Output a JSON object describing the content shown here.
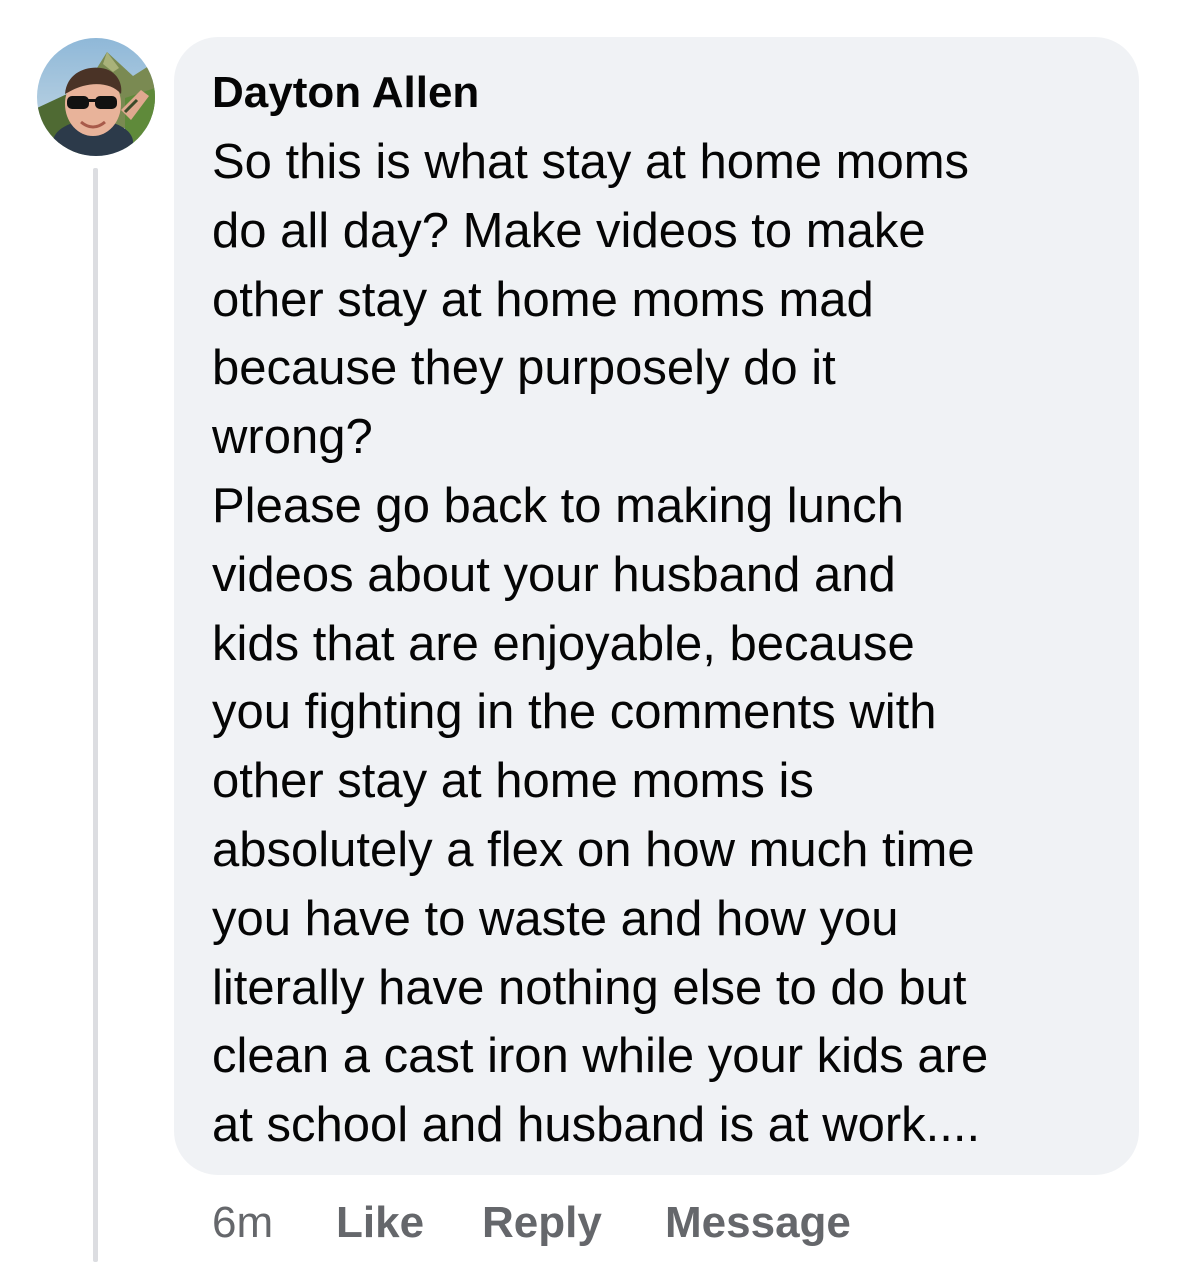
{
  "comment": {
    "author": "Dayton Allen",
    "avatar_icon": "profile-photo-man-sunglasses-mountains",
    "body_lines": [
      "So this is what stay at home moms",
      "do all day?  Make videos to make",
      "other stay at home moms mad",
      "because they purposely do it",
      "wrong?",
      "Please go back to making lunch",
      "videos about your husband and",
      "kids that are enjoyable, because",
      "you fighting in the comments with",
      "other stay at home moms is",
      "absolutely a flex on how much time",
      "you have to waste and how you",
      "literally have nothing else to do but",
      "clean a cast iron while your kids are",
      "at school and husband is at work...."
    ],
    "timestamp": "6m",
    "like_label": "Like",
    "reply_label": "Reply",
    "message_label": "Message"
  },
  "colors": {
    "bubble_bg": "#f0f2f5",
    "text": "#050505",
    "secondary_text": "#65676b",
    "thread_line": "#dcdde1"
  }
}
